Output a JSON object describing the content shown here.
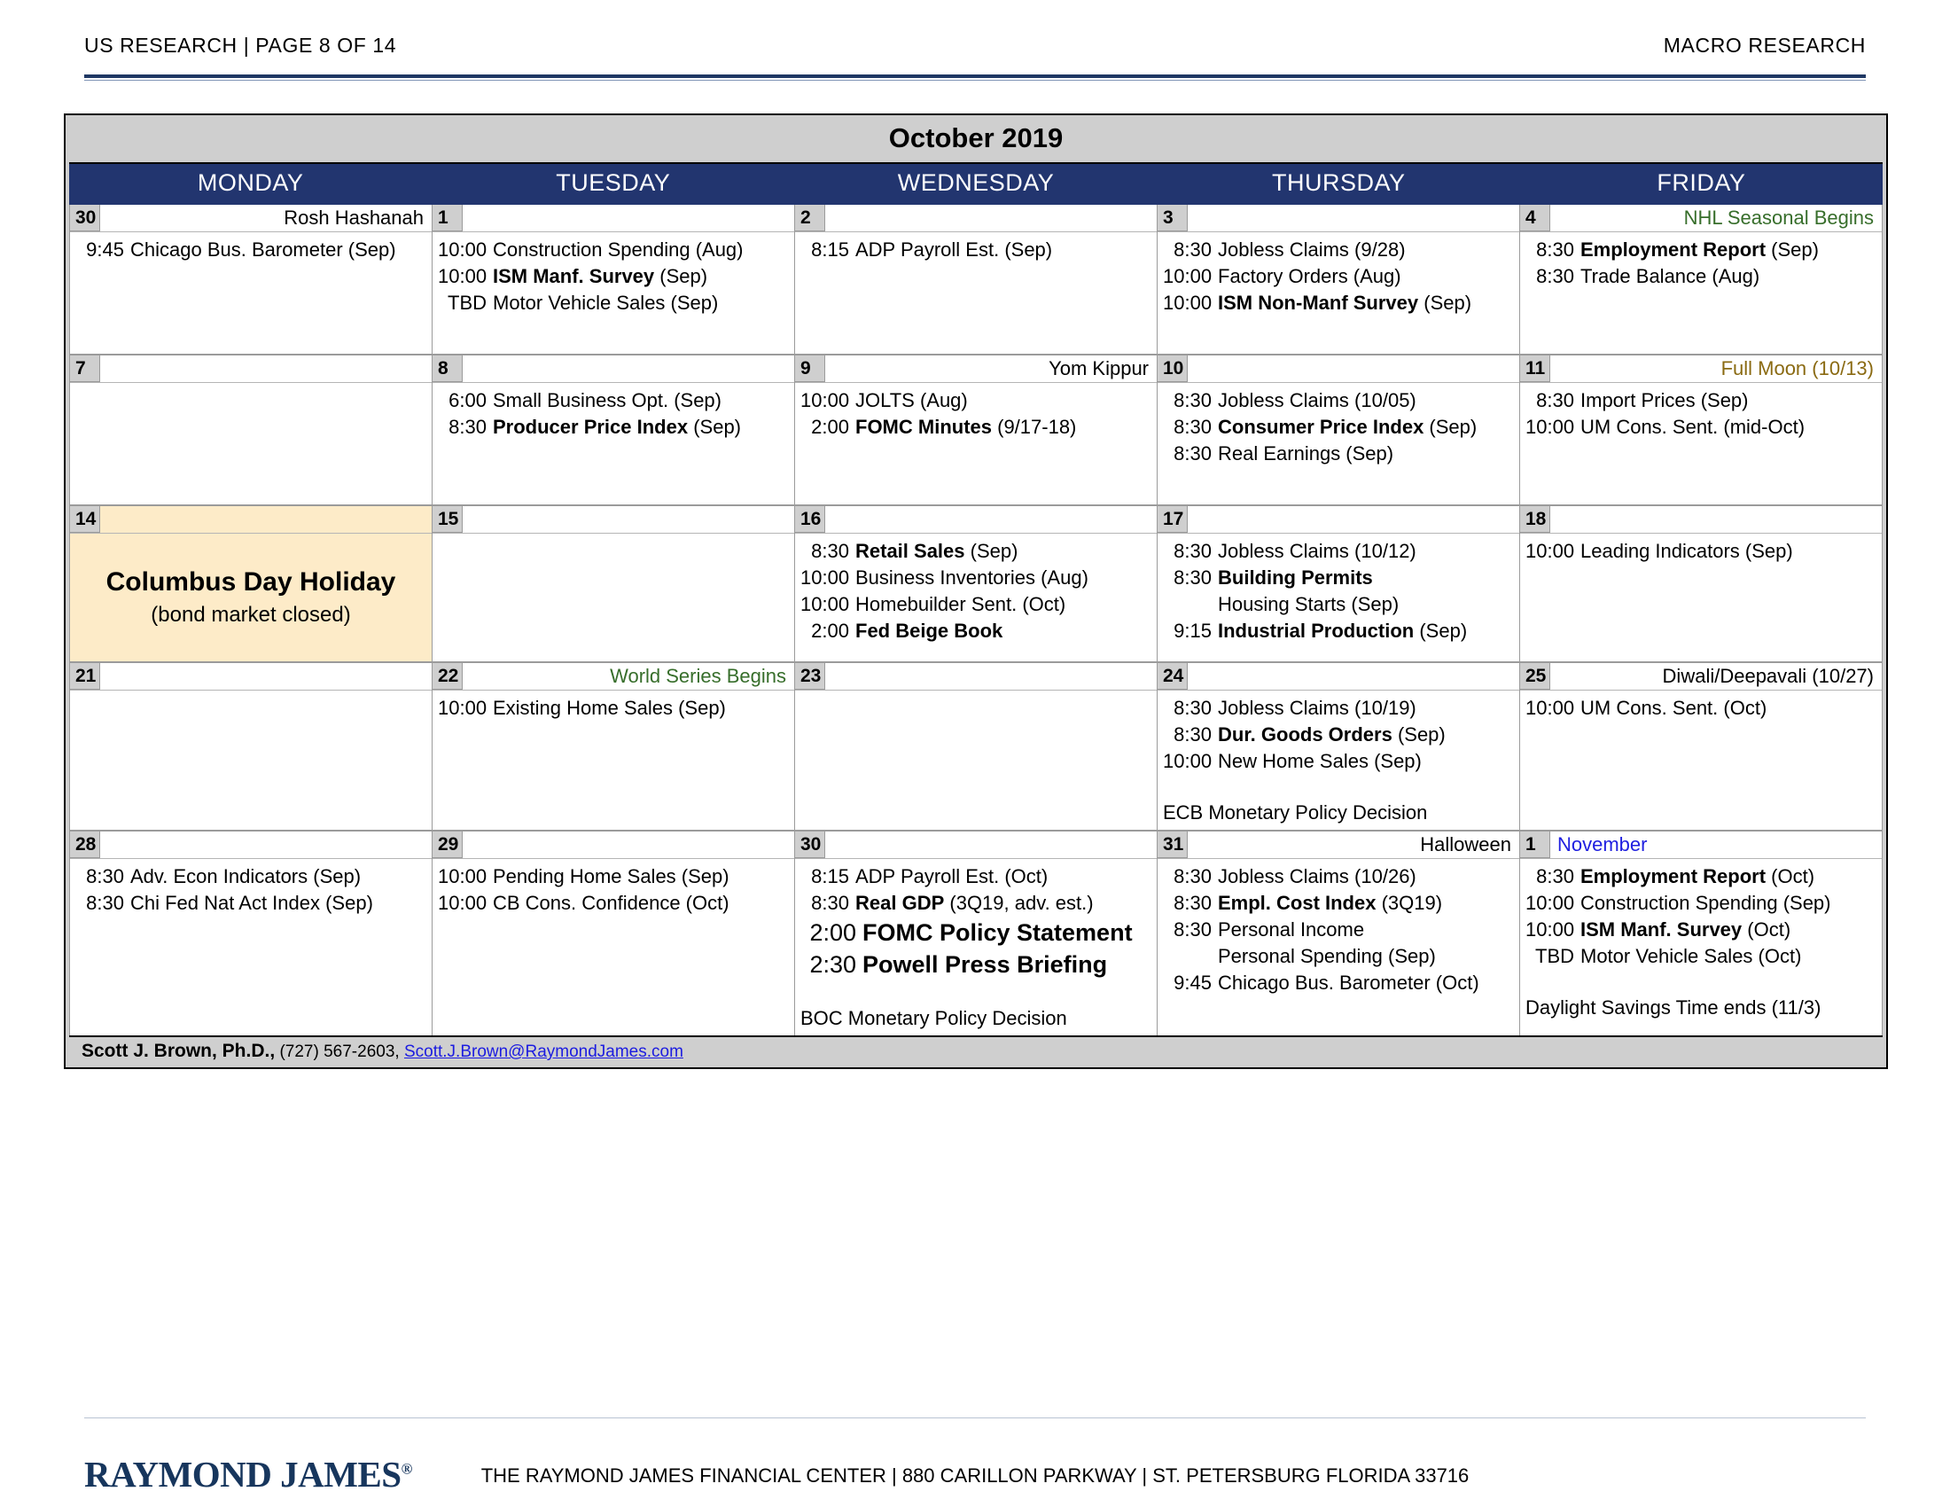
{
  "header": {
    "left": "US RESEARCH | PAGE 8 OF 14",
    "right": "MACRO RESEARCH"
  },
  "calendar": {
    "title": "October 2019",
    "day_headers": [
      "MONDAY",
      "TUESDAY",
      "WEDNESDAY",
      "THURSDAY",
      "FRIDAY"
    ],
    "weeks": [
      {
        "days": [
          {
            "num": "30",
            "note": "Rosh Hashanah",
            "note_color": "black",
            "events": [
              {
                "time": "9:45",
                "name": "Chicago Bus. Barometer (Sep)",
                "bold": false
              }
            ]
          },
          {
            "num": "1",
            "note": "",
            "events": [
              {
                "time": "10:00",
                "name": "Construction Spending (Aug)",
                "bold": false
              },
              {
                "time": "10:00",
                "name": "ISM Manf. Survey",
                "suffix": " (Sep)",
                "bold": true
              },
              {
                "time": "TBD",
                "name": " Motor Vehicle Sales (Sep)",
                "bold": false
              }
            ]
          },
          {
            "num": "2",
            "note": "",
            "events": [
              {
                "time": "8:15",
                "name": "ADP Payroll Est. (Sep)",
                "bold": false
              }
            ]
          },
          {
            "num": "3",
            "note": "",
            "events": [
              {
                "time": "8:30",
                "name": "Jobless Claims (9/28)",
                "bold": false
              },
              {
                "time": "10:00",
                "name": "Factory Orders (Aug)",
                "bold": false
              },
              {
                "time": "10:00",
                "name": "ISM Non-Manf Survey",
                "suffix": " (Sep)",
                "bold": true
              }
            ]
          },
          {
            "num": "4",
            "note": "NHL Seasonal Begins",
            "note_color": "green",
            "events": [
              {
                "time": "8:30",
                "name": "Employment Report",
                "suffix": " (Sep)",
                "bold": true
              },
              {
                "time": "8:30",
                "name": "Trade Balance (Aug)",
                "bold": false
              }
            ]
          }
        ]
      },
      {
        "days": [
          {
            "num": "7",
            "note": "",
            "events": []
          },
          {
            "num": "8",
            "note": "",
            "events": [
              {
                "time": "6:00",
                "name": "Small Business Opt. (Sep)",
                "bold": false
              },
              {
                "time": "8:30",
                "name": "Producer Price Index",
                "suffix": " (Sep)",
                "bold": true
              }
            ]
          },
          {
            "num": "9",
            "note": "Yom Kippur",
            "note_color": "black",
            "events": [
              {
                "time": "10:00",
                "name": "JOLTS (Aug)",
                "bold": false
              },
              {
                "time": "2:00",
                "name": "FOMC Minutes",
                "suffix": " (9/17-18)",
                "bold": true
              }
            ]
          },
          {
            "num": "10",
            "note": "",
            "events": [
              {
                "time": "8:30",
                "name": "Jobless Claims (10/05)",
                "bold": false
              },
              {
                "time": "8:30",
                "name": "Consumer Price Index",
                "suffix": " (Sep)",
                "bold": true
              },
              {
                "time": "8:30",
                "name": "Real Earnings (Sep)",
                "bold": false
              }
            ]
          },
          {
            "num": "11",
            "note": "Full Moon (10/13)",
            "note_color": "gold",
            "events": [
              {
                "time": "8:30",
                "name": "Import Prices (Sep)",
                "bold": false
              },
              {
                "time": "10:00",
                "name": "UM Cons. Sent. (mid-Oct)",
                "bold": false
              }
            ]
          }
        ]
      },
      {
        "days": [
          {
            "num": "14",
            "note": "",
            "holiday": true,
            "holiday_title": "Columbus Day Holiday",
            "holiday_sub": "(bond market closed)",
            "events": []
          },
          {
            "num": "15",
            "note": "",
            "events": []
          },
          {
            "num": "16",
            "note": "",
            "events": [
              {
                "time": "8:30",
                "name": "Retail Sales",
                "suffix": " (Sep)",
                "bold": true
              },
              {
                "time": "10:00",
                "name": "Business Inventories (Aug)",
                "bold": false
              },
              {
                "time": "10:00",
                "name": "Homebuilder Sent. (Oct)",
                "bold": false
              },
              {
                "time": "2:00",
                "name": "Fed Beige Book",
                "bold": true
              }
            ]
          },
          {
            "num": "17",
            "note": "",
            "events": [
              {
                "time": "8:30",
                "name": "Jobless Claims (10/12)",
                "bold": false
              },
              {
                "time": "8:30",
                "name": "Building Permits",
                "bold": true
              },
              {
                "time": "",
                "name": "     Housing Starts (Sep)",
                "bold": false
              },
              {
                "time": "9:15",
                "name": "Industrial Production",
                "suffix": " (Sep)",
                "bold": true
              }
            ]
          },
          {
            "num": "18",
            "note": "",
            "events": [
              {
                "time": "10:00",
                "name": "Leading Indicators (Sep)",
                "bold": false
              }
            ]
          }
        ]
      },
      {
        "days": [
          {
            "num": "21",
            "note": "",
            "events": []
          },
          {
            "num": "22",
            "note": "World Series Begins",
            "note_color": "green",
            "events": [
              {
                "time": "10:00",
                "name": "Existing Home Sales (Sep)",
                "bold": false
              }
            ]
          },
          {
            "num": "23",
            "note": "",
            "events": []
          },
          {
            "num": "24",
            "note": "",
            "events": [
              {
                "time": "8:30",
                "name": "Jobless Claims (10/19)",
                "bold": false
              },
              {
                "time": "8:30",
                "name": "Dur. Goods Orders",
                "suffix": " (Sep)",
                "bold": true
              },
              {
                "time": "10:00",
                "name": "New Home Sales (Sep)",
                "bold": false
              },
              {
                "spacer": true
              },
              {
                "time": "",
                "name": "ECB Monetary Policy Decision",
                "bold": false,
                "note_line": true
              }
            ]
          },
          {
            "num": "25",
            "note": "Diwali/Deepavali (10/27)",
            "note_color": "black",
            "events": [
              {
                "time": "10:00",
                "name": "UM Cons. Sent. (Oct)",
                "bold": false
              }
            ]
          }
        ]
      },
      {
        "days": [
          {
            "num": "28",
            "note": "",
            "events": [
              {
                "time": "8:30",
                "name": "Adv. Econ Indicators (Sep)",
                "bold": false
              },
              {
                "time": "8:30",
                "name": "Chi Fed Nat Act Index (Sep)",
                "bold": false
              }
            ]
          },
          {
            "num": "29",
            "note": "",
            "events": [
              {
                "time": "10:00",
                "name": "Pending Home Sales (Sep)",
                "bold": false
              },
              {
                "time": "10:00",
                "name": "CB Cons. Confidence (Oct)",
                "bold": false
              }
            ]
          },
          {
            "num": "30",
            "note": "",
            "events": [
              {
                "time": "8:15",
                "name": "ADP Payroll Est. (Oct)",
                "bold": false
              },
              {
                "time": "8:30",
                "name": "Real GDP",
                "suffix": " (3Q19, adv. est.)",
                "bold": true
              },
              {
                "time": "2:00",
                "name": "FOMC Policy Statement",
                "bold": true,
                "big": true
              },
              {
                "time": "2:30",
                "name": "Powell Press Briefing",
                "bold": true,
                "big": true
              },
              {
                "spacer": true
              },
              {
                "time": "",
                "name": "BOC Monetary Policy Decision",
                "bold": false,
                "note_line": true
              }
            ]
          },
          {
            "num": "31",
            "note": "Halloween",
            "note_color": "black",
            "events": [
              {
                "time": "8:30",
                "name": "Jobless Claims (10/26)",
                "bold": false
              },
              {
                "time": "8:30",
                "name": "Empl. Cost Index",
                "suffix": " (3Q19)",
                "bold": true
              },
              {
                "time": "8:30",
                "name": "Personal Income",
                "bold": false
              },
              {
                "time": "",
                "name": "     Personal Spending (Sep)",
                "bold": false
              },
              {
                "time": "9:45",
                "name": "Chicago Bus. Barometer (Oct)",
                "bold": false
              }
            ]
          },
          {
            "num": "1",
            "note": "November",
            "note_color": "blue",
            "note_align_left": true,
            "events": [
              {
                "time": "8:30",
                "name": "Employment Report",
                "suffix": " (Oct)",
                "bold": true
              },
              {
                "time": "10:00",
                "name": "Construction Spending (Sep)",
                "bold": false
              },
              {
                "time": "10:00",
                "name": "ISM Manf. Survey",
                "suffix": " (Oct)",
                "bold": true
              },
              {
                "time": "TBD",
                "name": " Motor Vehicle Sales (Oct)",
                "bold": false
              },
              {
                "spacer": true
              },
              {
                "time": "",
                "name": "Daylight Savings Time ends (11/3)",
                "bold": false,
                "note_line": true
              }
            ]
          }
        ]
      }
    ],
    "footer": {
      "author": "Scott J. Brown, Ph.D.,",
      "phone": " (727) 567-2603,",
      "email": "Scott.J.Brown@RaymondJames.com"
    }
  },
  "page_footer": {
    "logo": "RAYMOND JAMES",
    "logo_mark": "®",
    "address": "THE RAYMOND JAMES FINANCIAL CENTER | 880 CARILLON PARKWAY | ST. PETERSBURG FLORIDA 33716"
  }
}
